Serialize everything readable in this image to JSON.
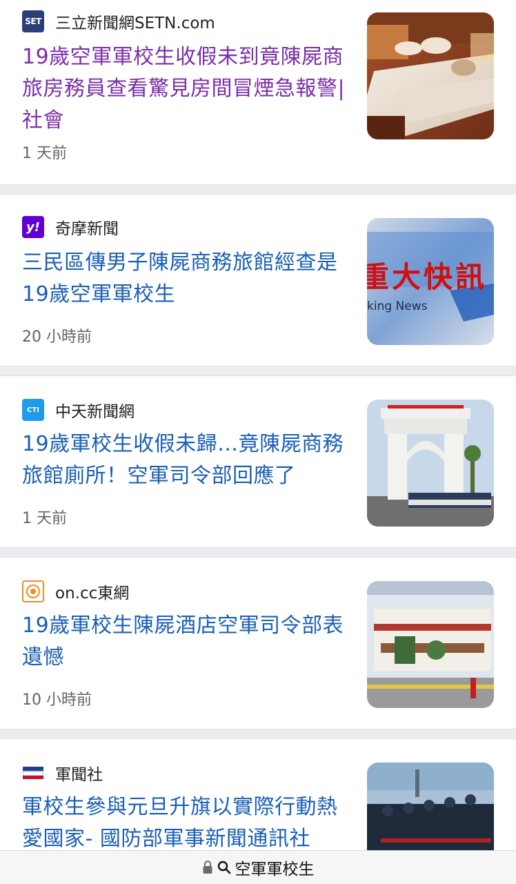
{
  "articles": [
    {
      "source": "三立新聞網SETN.com",
      "favicon_text": "SET",
      "headline": "19歲空軍軍校生收假未到竟陳屍商旅房務員查看驚見房間冒煙急報警| 社會",
      "time": "1 天前",
      "visited": true,
      "thumbnail": "hotel-room-bed-photo"
    },
    {
      "source": "奇摩新聞",
      "favicon_text": "y!",
      "headline": "三民區傳男子陳屍商務旅館經查是19歲空軍軍校生",
      "time": "20 小時前",
      "visited": false,
      "thumbnail": "breaking-news-banner-photo",
      "thumbnail_text": "重大快訊",
      "thumbnail_subtext": "king News"
    },
    {
      "source": "中天新聞網",
      "favicon_text": "CTI",
      "headline": "19歲軍校生收假未歸…竟陳屍商務旅館廁所！空軍司令部回應了",
      "time": "1 天前",
      "visited": false,
      "thumbnail": "academy-gate-photo"
    },
    {
      "source": "on.cc東網",
      "favicon_text": "",
      "headline": "19歲軍校生陳屍酒店空軍司令部表遺憾",
      "time": "10 小時前",
      "visited": false,
      "thumbnail": "academy-entrance-photo"
    },
    {
      "source": "軍聞社",
      "favicon_text": "",
      "headline": "軍校生參與元旦升旗以實際行動熱愛國家- 國防部軍事新聞通訊社",
      "time": "",
      "visited": false,
      "thumbnail": "flag-ceremony-photo"
    }
  ],
  "address_bar": {
    "query": "空軍軍校生",
    "lock_icon": "lock-icon",
    "search_icon": "search-icon"
  },
  "colors": {
    "link": "#1a5fb4",
    "visited_link": "#7b2ea8",
    "meta_text": "#5f6368",
    "setn_brand": "#2b3f75",
    "yahoo_brand": "#6001d2",
    "ctitv_brand": "#1e9be9",
    "oncc_brand": "#f08a24"
  }
}
